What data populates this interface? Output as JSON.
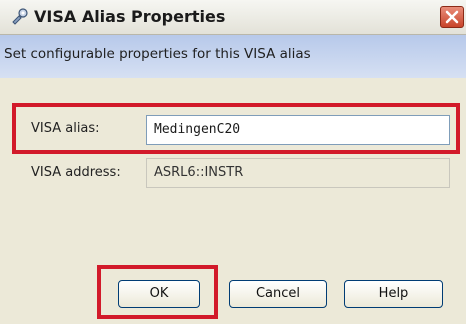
{
  "window": {
    "title": "VISA Alias Properties",
    "icon": "visa-properties-icon",
    "close_icon": "close-icon"
  },
  "header": {
    "description": "Set configurable properties for this VISA alias"
  },
  "form": {
    "alias_label": "VISA alias:",
    "alias_value": "MedingenC20",
    "address_label": "VISA address:",
    "address_value": "ASRL6::INSTR"
  },
  "buttons": {
    "ok": "OK",
    "cancel": "Cancel",
    "help": "Help"
  },
  "colors": {
    "highlight": "#d21a2a",
    "header_band": "#c3d2ee",
    "dialog_background": "#ece9d8"
  }
}
